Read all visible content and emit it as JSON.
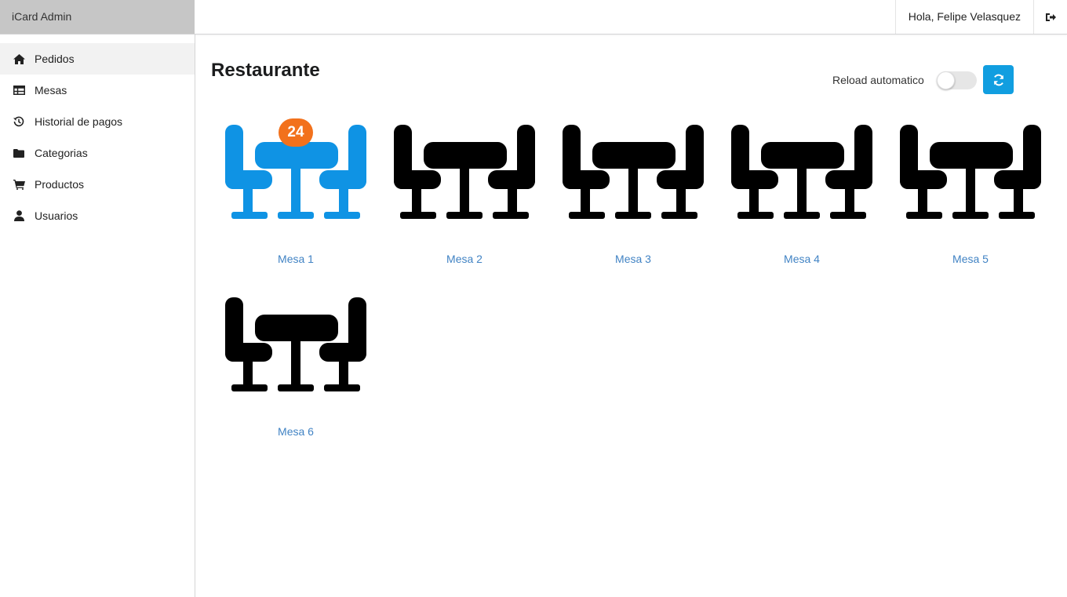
{
  "app": {
    "brand": "iCard Admin"
  },
  "header": {
    "greeting": "Hola, Felipe Velasquez",
    "logout_icon": "sign-out-icon"
  },
  "sidebar": {
    "items": [
      {
        "label": "Pedidos",
        "icon": "home-icon",
        "active": true
      },
      {
        "label": "Mesas",
        "icon": "table-icon",
        "active": false
      },
      {
        "label": "Historial de pagos",
        "icon": "history-icon",
        "active": false
      },
      {
        "label": "Categorias",
        "icon": "folder-icon",
        "active": false
      },
      {
        "label": "Productos",
        "icon": "cart-icon",
        "active": false
      },
      {
        "label": "Usuarios",
        "icon": "user-icon",
        "active": false
      }
    ]
  },
  "main": {
    "title": "Restaurante",
    "reload_label": "Reload automatico",
    "reload_enabled": false,
    "refresh_icon": "refresh-icon",
    "tables": [
      {
        "label": "Mesa 1",
        "pending": "24",
        "highlight": true
      },
      {
        "label": "Mesa 2",
        "pending": "",
        "highlight": false
      },
      {
        "label": "Mesa 3",
        "pending": "",
        "highlight": false
      },
      {
        "label": "Mesa 4",
        "pending": "",
        "highlight": false
      },
      {
        "label": "Mesa 5",
        "pending": "",
        "highlight": false
      },
      {
        "label": "Mesa 6",
        "pending": "",
        "highlight": false
      }
    ]
  },
  "colors": {
    "accent": "#119ee0",
    "table_active": "#0f93e4",
    "table_idle": "#000000",
    "badge": "#f2711c",
    "link": "#4183c4"
  }
}
